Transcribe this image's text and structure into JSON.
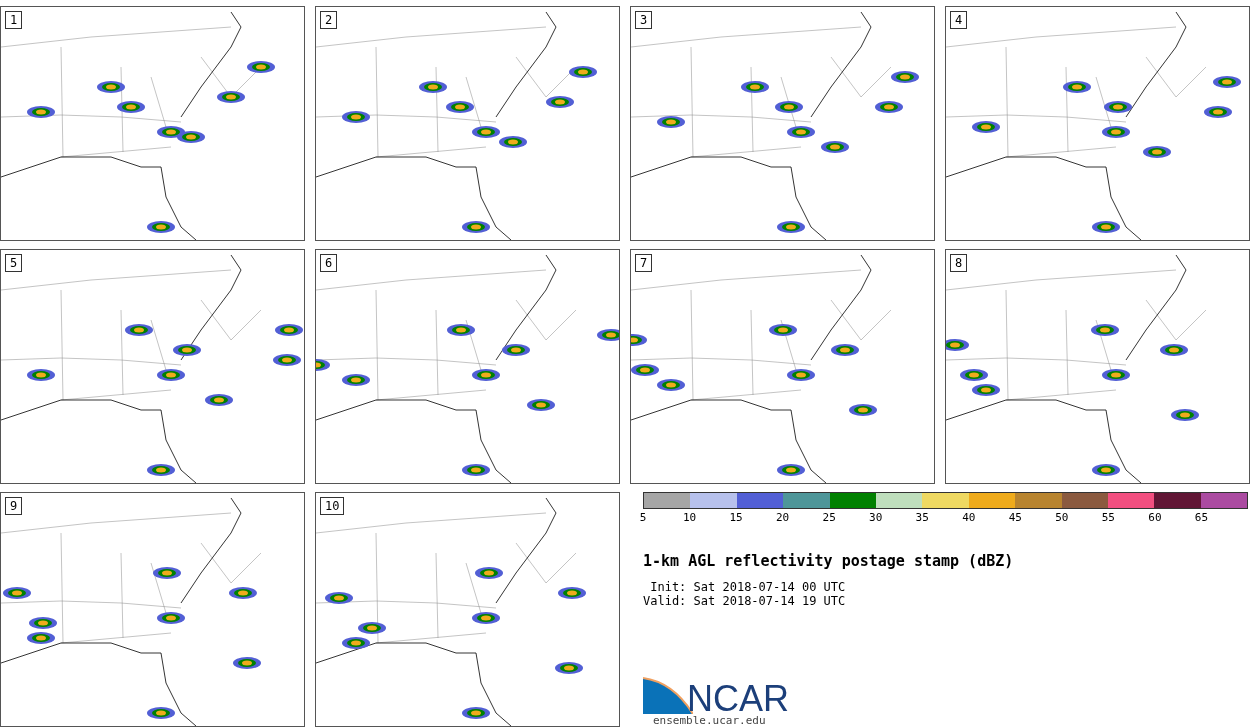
{
  "panels": [
    {
      "label": "1"
    },
    {
      "label": "2"
    },
    {
      "label": "3"
    },
    {
      "label": "4"
    },
    {
      "label": "5"
    },
    {
      "label": "6"
    },
    {
      "label": "7"
    },
    {
      "label": "8"
    },
    {
      "label": "9"
    },
    {
      "label": "10"
    }
  ],
  "colorbar": {
    "bins": [
      {
        "color": "#a6a6a6"
      },
      {
        "color": "#b7c1ec"
      },
      {
        "color": "#525fd5"
      },
      {
        "color": "#4e9699"
      },
      {
        "color": "#018101"
      },
      {
        "color": "#bfdfbd"
      },
      {
        "color": "#efd962"
      },
      {
        "color": "#efab1c"
      },
      {
        "color": "#b8842f"
      },
      {
        "color": "#8b5a3f"
      },
      {
        "color": "#f24f80"
      },
      {
        "color": "#611635"
      },
      {
        "color": "#ab4ba1"
      }
    ],
    "ticks": [
      "5",
      "10",
      "15",
      "20",
      "25",
      "30",
      "35",
      "40",
      "45",
      "50",
      "55",
      "60",
      "65"
    ]
  },
  "title": "1-km AGL reflectivity postage stamp (dBZ)",
  "init": " Init: Sat 2018-07-14 00 UTC",
  "valid": "Valid: Sat 2018-07-14 19 UTC",
  "logo": {
    "text": "NCAR",
    "url": "ensemble.ucar.edu"
  }
}
